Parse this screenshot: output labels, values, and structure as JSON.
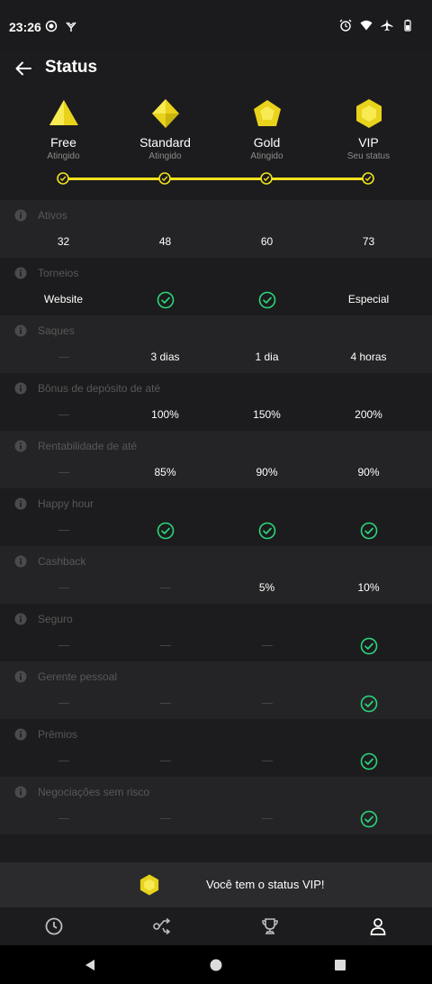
{
  "status_bar": {
    "time": "23:26",
    "left_icons": [
      "screen-record-icon",
      "cast-icon"
    ],
    "right_icons": [
      "alarm-icon",
      "wifi-icon",
      "airplane-mode-icon",
      "battery-icon"
    ]
  },
  "header": {
    "back_icon": "back-arrow-icon",
    "title": "Status"
  },
  "tiers": [
    {
      "name": "Free",
      "sub": "Atingido",
      "icon": "triangle-gem-icon"
    },
    {
      "name": "Standard",
      "sub": "Atingido",
      "icon": "diamond-gem-icon"
    },
    {
      "name": "Gold",
      "sub": "Atingido",
      "icon": "pentagon-gem-icon"
    },
    {
      "name": "VIP",
      "sub": "Seu status",
      "icon": "hexagon-gem-icon"
    }
  ],
  "colors": {
    "accent": "#f2e21f",
    "check": "#2bd67b",
    "background": "#1c1c1e",
    "row_alt": "#242426"
  },
  "rows": [
    {
      "label": "Ativos",
      "cells": [
        "32",
        "48",
        "60",
        "73"
      ]
    },
    {
      "label": "Torneios",
      "cells": [
        "Website",
        "check",
        "check",
        "Especial"
      ]
    },
    {
      "label": "Saques",
      "cells": [
        "dash",
        "3 dias",
        "1 dia",
        "4 horas"
      ]
    },
    {
      "label": "Bônus de depósito de até",
      "cells": [
        "dash",
        "100%",
        "150%",
        "200%"
      ]
    },
    {
      "label": "Rentabilidade de até",
      "cells": [
        "dash",
        "85%",
        "90%",
        "90%"
      ]
    },
    {
      "label": "Happy hour",
      "cells": [
        "dash",
        "check",
        "check",
        "check"
      ]
    },
    {
      "label": "Cashback",
      "cells": [
        "dash",
        "dash",
        "5%",
        "10%"
      ]
    },
    {
      "label": "Seguro",
      "cells": [
        "dash",
        "dash",
        "dash",
        "check"
      ]
    },
    {
      "label": "Gerente pessoal",
      "cells": [
        "dash",
        "dash",
        "dash",
        "check"
      ]
    },
    {
      "label": "Prêmios",
      "cells": [
        "dash",
        "dash",
        "dash",
        "check"
      ]
    },
    {
      "label": "Negociações sem risco",
      "cells": [
        "dash",
        "dash",
        "dash",
        "check"
      ]
    }
  ],
  "banner": {
    "icon": "hexagon-gem-icon",
    "text": "Você tem o status VIP!"
  },
  "tab_bar": {
    "tabs": [
      "history-clock-icon",
      "shuffle-icon",
      "trophy-icon",
      "profile-icon"
    ],
    "active_tab": "profile-icon"
  },
  "nav_bar": [
    "nav-back-icon",
    "nav-home-icon",
    "nav-recents-icon"
  ]
}
